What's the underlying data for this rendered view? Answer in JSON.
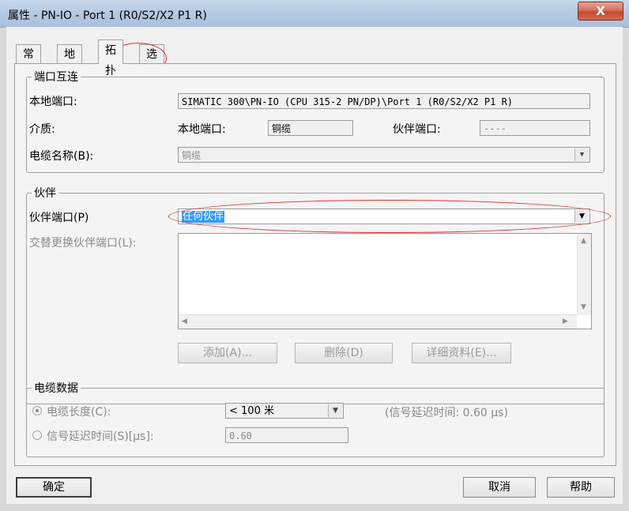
{
  "window": {
    "title": "属性 - PN-IO - Port 1 (R0/S2/X2 P1 R)",
    "close_glyph": "X"
  },
  "tabs": [
    {
      "label": "常规"
    },
    {
      "label": "地址"
    },
    {
      "label": "拓扑"
    },
    {
      "label": "选项"
    }
  ],
  "active_tab": "拓扑",
  "port_interconnect": {
    "legend": "端口互连",
    "local_port_label": "本地端口:",
    "local_port_value": "SIMATIC 300\\PN-IO (CPU 315-2 PN/DP)\\Port 1 (R0/S2/X2 P1 R)",
    "medium_label": "介质:",
    "medium_local_label": "本地端口:",
    "medium_local_value": "铜缆",
    "medium_partner_label": "伙伴端口:",
    "medium_partner_value": "----",
    "cable_name_label": "电缆名称(B):",
    "cable_name_value": "铜缆"
  },
  "partner": {
    "legend": "伙伴",
    "partner_port_label": "伙伴端口(P)",
    "partner_port_value": "任何伙伴",
    "alternate_label": "交替更换伙伴端口(L):",
    "buttons": {
      "add": "添加(A)...",
      "delete": "删除(D)",
      "details": "详细资料(E)..."
    }
  },
  "cable_data": {
    "legend": "电缆数据",
    "cable_length_label": "电缆长度(C):",
    "cable_length_value": "< 100 米",
    "signal_delay_info": "(信号延迟时间: 0.60 μs)",
    "signal_delay_label": "信号延迟时间(S)[μs]:",
    "signal_delay_value": "0.60",
    "selected_option": "电缆长度(C):"
  },
  "footer": {
    "ok": "确定",
    "cancel": "取消",
    "help": "帮助"
  }
}
